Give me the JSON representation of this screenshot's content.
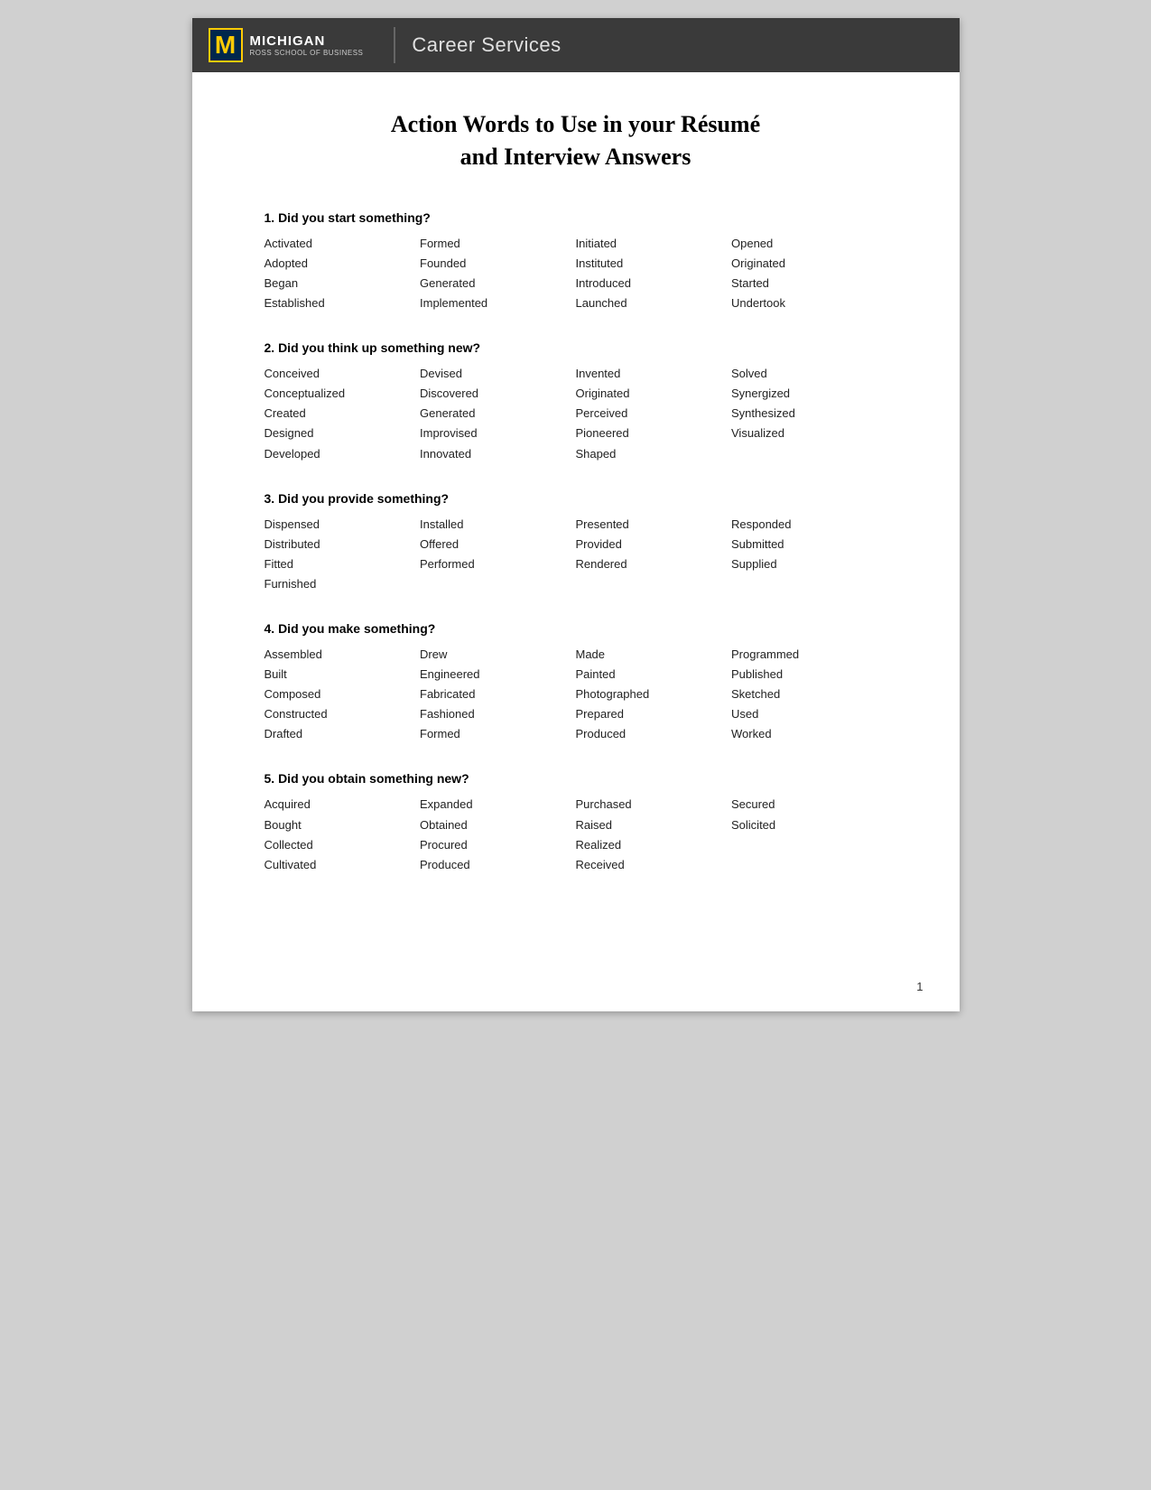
{
  "header": {
    "logo_m": "M",
    "michigan": "MICHIGAN",
    "ross": "ROSS SCHOOL OF BUSINESS",
    "career_services": "Career Services"
  },
  "title": {
    "line1": "Action Words to Use in your Résumé",
    "line2": "and Interview Answers"
  },
  "sections": [
    {
      "id": "section1",
      "heading": "1. Did you start something?",
      "columns": [
        [
          "Activated",
          "Adopted",
          "Began",
          "Established"
        ],
        [
          "Formed",
          "Founded",
          "Generated",
          "Implemented"
        ],
        [
          "Initiated",
          "Instituted",
          "Introduced",
          "Launched"
        ],
        [
          "Opened",
          "Originated",
          "Started",
          "Undertook"
        ]
      ]
    },
    {
      "id": "section2",
      "heading": "2. Did you think up something new?",
      "columns": [
        [
          "Conceived",
          "Conceptualized",
          "Created",
          "Designed",
          "Developed"
        ],
        [
          "Devised",
          "Discovered",
          "Generated",
          "Improvised",
          "Innovated"
        ],
        [
          "Invented",
          "Originated",
          "Perceived",
          "Pioneered",
          "Shaped"
        ],
        [
          "Solved",
          "Synergized",
          "Synthesized",
          "Visualized"
        ]
      ]
    },
    {
      "id": "section3",
      "heading": "3. Did you provide something?",
      "columns": [
        [
          "Dispensed",
          "Distributed",
          "Fitted",
          "Furnished"
        ],
        [
          "Installed",
          "Offered",
          "Performed"
        ],
        [
          "Presented",
          "Provided",
          "Rendered"
        ],
        [
          "Responded",
          "Submitted",
          "Supplied"
        ]
      ]
    },
    {
      "id": "section4",
      "heading": "4. Did you make something?",
      "columns": [
        [
          "Assembled",
          "Built",
          "Composed",
          "Constructed",
          "Drafted"
        ],
        [
          "Drew",
          "Engineered",
          "Fabricated",
          "Fashioned",
          "Formed"
        ],
        [
          "Made",
          "Painted",
          "Photographed",
          "Prepared",
          "Produced"
        ],
        [
          "Programmed",
          "Published",
          "Sketched",
          "Used",
          "Worked"
        ]
      ]
    },
    {
      "id": "section5",
      "heading": "5. Did you obtain something new?",
      "columns": [
        [
          "Acquired",
          "Bought",
          "Collected",
          "Cultivated"
        ],
        [
          "Expanded",
          "Obtained",
          "Procured",
          "Produced"
        ],
        [
          "Purchased",
          "Raised",
          "Realized",
          "Received"
        ],
        [
          "Secured",
          "Solicited"
        ]
      ]
    }
  ],
  "page_number": "1"
}
